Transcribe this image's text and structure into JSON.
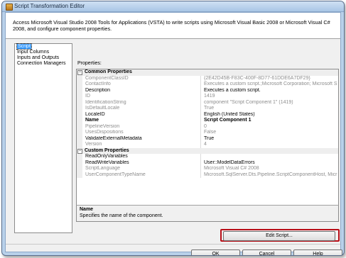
{
  "window": {
    "title": "Script Transformation Editor"
  },
  "header": {
    "description": "Access Microsoft Visual Studio 2008 Tools for Applications (VSTA) to write scripts using Microsoft Visual Basic 2008 or Microsoft Visual C# 2008, and configure component properties."
  },
  "nav": {
    "items": [
      "Script",
      "Input Columns",
      "Inputs and Outputs",
      "Connection Managers"
    ]
  },
  "properties": {
    "label": "Properties:",
    "common": {
      "title": "Common Properties",
      "rows": [
        {
          "name": "ComponentClassID",
          "value": "{2E42D45B-F83C-400F-8D77-61DDE6A7DF29}"
        },
        {
          "name": "ContactInfo",
          "value": "Executes a custom script.;Microsoft Corporation; Microsoft S"
        },
        {
          "name": "Description",
          "value": "Executes a custom script."
        },
        {
          "name": "ID",
          "value": "1419"
        },
        {
          "name": "IdentificationString",
          "value": "component \"Script Component 1\" (1419)"
        },
        {
          "name": "IsDefaultLocale",
          "value": "True"
        },
        {
          "name": "LocaleID",
          "value": "English (United States)"
        },
        {
          "name": "Name",
          "value": "Script Component 1"
        },
        {
          "name": "PipelineVersion",
          "value": "0"
        },
        {
          "name": "UsesDispositions",
          "value": "False"
        },
        {
          "name": "ValidateExternalMetadata",
          "value": "True"
        },
        {
          "name": "Version",
          "value": "4"
        }
      ]
    },
    "custom": {
      "title": "Custom Properties",
      "rows": [
        {
          "name": "ReadOnlyVariables",
          "value": ""
        },
        {
          "name": "ReadWriteVariables",
          "value": "User::ModelDataErrors"
        },
        {
          "name": "ScriptLanguage",
          "value": "Microsoft Visual C# 2008"
        },
        {
          "name": "UserComponentTypeName",
          "value": "Microsoft.SqlServer.Dts.Pipeline.ScriptComponentHost, Micr"
        }
      ]
    }
  },
  "help": {
    "title": "Name",
    "text": "Specifies the name of the component."
  },
  "buttons": {
    "edit_script": "Edit Script...",
    "ok": "OK",
    "cancel": "Cancel",
    "help": "Help"
  }
}
